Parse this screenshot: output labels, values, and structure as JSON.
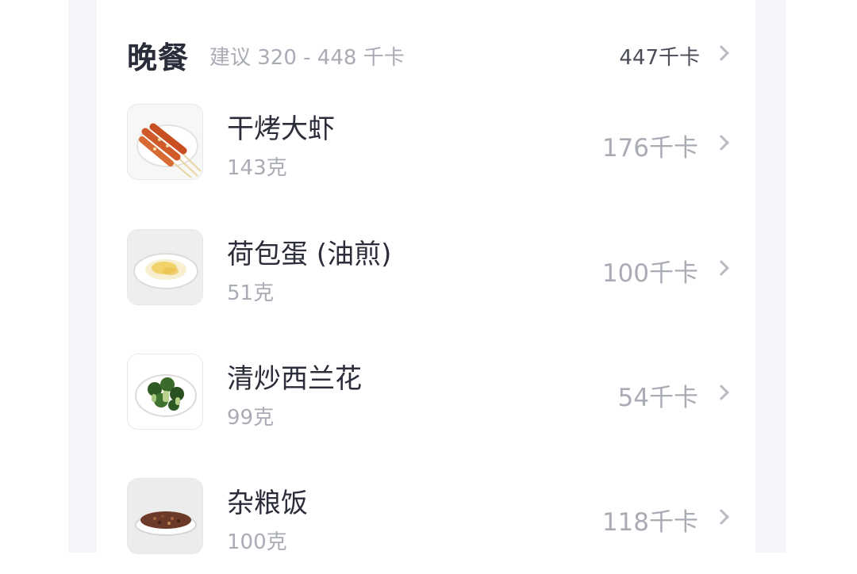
{
  "meal": {
    "title": "晚餐",
    "suggestion": "建议 320 - 448 千卡",
    "total": "447千卡"
  },
  "foods": [
    {
      "name": "干烤大虾",
      "weight": "143克",
      "kcal": "176千卡",
      "icon": "grilled-shrimp-skewers"
    },
    {
      "name": "荷包蛋 (油煎)",
      "weight": "51克",
      "kcal": "100千卡",
      "icon": "fried-egg-plate"
    },
    {
      "name": "清炒西兰花",
      "weight": "99克",
      "kcal": "54千卡",
      "icon": "broccoli-plate"
    },
    {
      "name": "杂粮饭",
      "weight": "100克",
      "kcal": "118千卡",
      "icon": "mixed-grain-rice-plate"
    }
  ],
  "colors": {
    "title": "#2b2d3a",
    "secondary": "#a9acb5",
    "page_band": "#f4f5f9"
  }
}
